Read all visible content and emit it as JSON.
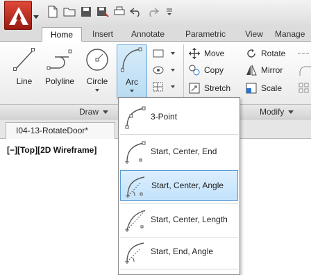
{
  "quick_access": {
    "icons": [
      "new-icon",
      "open-icon",
      "save-icon",
      "save-as-icon",
      "print-icon",
      "undo-icon",
      "redo-icon",
      "customize-icon"
    ]
  },
  "tabs": [
    {
      "label": "Home",
      "active": true
    },
    {
      "label": "Insert"
    },
    {
      "label": "Annotate"
    },
    {
      "label": "Parametric"
    },
    {
      "label": "View"
    },
    {
      "label": "Manage"
    }
  ],
  "draw_panel": {
    "label": "Draw",
    "tools": [
      {
        "label": "Line"
      },
      {
        "label": "Polyline"
      },
      {
        "label": "Circle"
      },
      {
        "label": "Arc"
      }
    ]
  },
  "modify_panel": {
    "label": "Modify",
    "tools": [
      {
        "label": "Move"
      },
      {
        "label": "Copy"
      },
      {
        "label": "Stretch"
      },
      {
        "label": "Rotate"
      },
      {
        "label": "Mirror"
      },
      {
        "label": "Scale"
      }
    ]
  },
  "document": {
    "tab_label": "I04-13-RotateDoor*",
    "viewport_label": "[−][Top][2D Wireframe]"
  },
  "arc_menu": {
    "items": [
      {
        "label": "3-Point"
      },
      {
        "label": "Start, Center, End"
      },
      {
        "label": "Start, Center, Angle",
        "highlighted": true
      },
      {
        "label": "Start, Center, Length"
      },
      {
        "label": "Start, End, Angle"
      }
    ]
  }
}
